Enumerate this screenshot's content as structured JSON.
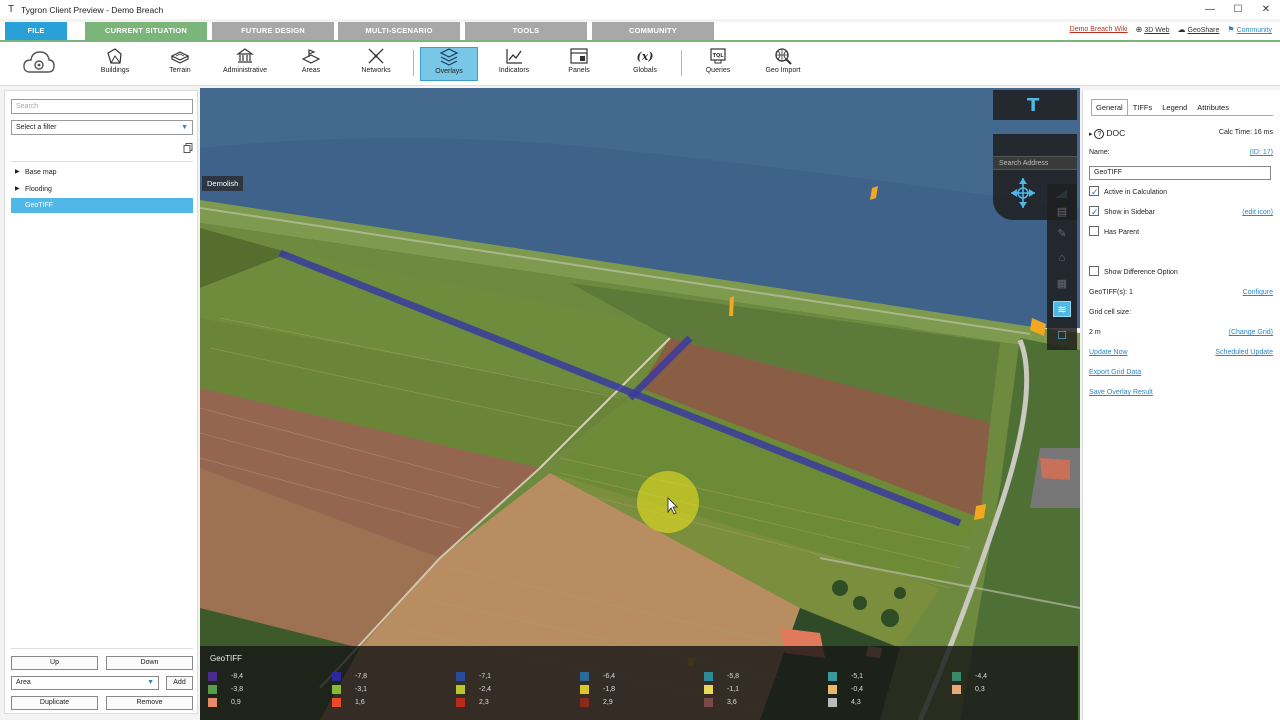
{
  "window": {
    "title": "Tygron Client Preview - Demo Breach",
    "controls": [
      "—",
      "☐",
      "✕"
    ]
  },
  "tabs": {
    "file": "FILE",
    "current": "CURRENT SITUATION",
    "future": "FUTURE DESIGN",
    "multi": "MULTI-SCENARIO",
    "tools": "TOOLS",
    "community": "COMMUNITY"
  },
  "toplinks": {
    "wiki": "Demo Breach Wiki",
    "web3d": "3D Web",
    "geoshare": "GeoShare",
    "community": "Community"
  },
  "toolbar": {
    "buildings": "Buildings",
    "terrain": "Terrain",
    "administrative": "Administrative",
    "areas": "Areas",
    "networks": "Networks",
    "overlays": "Overlays",
    "indicators": "Indicators",
    "panels": "Panels",
    "globals": "Globals",
    "queries": "Queries",
    "geoimport": "Geo Import"
  },
  "left_panel": {
    "search_placeholder": "Search",
    "filter_value": "Select a filter",
    "tree": [
      {
        "label": "Base map",
        "expandable": true,
        "selected": false
      },
      {
        "label": "Flooding",
        "expandable": true,
        "selected": false
      },
      {
        "label": "GeoTIFF",
        "expandable": false,
        "selected": true
      }
    ],
    "up": "Up",
    "down": "Down",
    "type_select": "Area",
    "add": "Add",
    "duplicate": "Duplicate",
    "remove": "Remove"
  },
  "viewport": {
    "demolish_label": "Demolish",
    "search_address": "Search Address",
    "legend": {
      "title": "GeoTIFF",
      "items": [
        {
          "value": "-8,4",
          "color": "#4a2a8a"
        },
        {
          "value": "-7,8",
          "color": "#2a2a9a"
        },
        {
          "value": "-7,1",
          "color": "#2a4a9a"
        },
        {
          "value": "-6,4",
          "color": "#2a6a9a"
        },
        {
          "value": "-5,8",
          "color": "#2a8a9a"
        },
        {
          "value": "-5,1",
          "color": "#3a9a9a"
        },
        {
          "value": "-4,4",
          "color": "#3a8a6a"
        },
        {
          "value": "-3,8",
          "color": "#5a9a4a"
        },
        {
          "value": "-3,1",
          "color": "#8ab83a"
        },
        {
          "value": "-2,4",
          "color": "#b8c82a"
        },
        {
          "value": "-1,8",
          "color": "#d8c82a"
        },
        {
          "value": "-1,1",
          "color": "#e8d85a"
        },
        {
          "value": "-0,4",
          "color": "#e8b86a"
        },
        {
          "value": "0,3",
          "color": "#e8a87a"
        },
        {
          "value": "0,9",
          "color": "#e88a6a"
        },
        {
          "value": "1,6",
          "color": "#e84a2a"
        },
        {
          "value": "2,3",
          "color": "#b82a1a"
        },
        {
          "value": "2,9",
          "color": "#8a2a1a"
        },
        {
          "value": "3,6",
          "color": "#7a4a4a"
        },
        {
          "value": "4,3",
          "color": "#bbbbbb"
        }
      ]
    }
  },
  "right_panel": {
    "tabs": [
      "General",
      "TIFFs",
      "Legend",
      "Attributes"
    ],
    "doc_label": "DOC",
    "calc_time": "Calc Time: 16 ms",
    "name_label": "Name:",
    "id_link": "(ID: 17)",
    "name_value": "GeoTIFF",
    "active_in_calc": "Active in Calculation",
    "show_in_sidebar": "Show in Sidebar",
    "edit_icon": "(edit icon)",
    "has_parent": "Has Parent",
    "show_difference": "Show Difference Option",
    "geotiffs": "GeoTIFF(s): 1",
    "configure": "Configure",
    "grid_cell_size": "Grid cell size:",
    "grid_value": "2 m",
    "change_grid": "(Change Grid)",
    "update_now": "Update Now",
    "scheduled_update": "Scheduled Update",
    "export_grid": "Export Grid Data",
    "save_overlay": "Save Overlay Result"
  }
}
